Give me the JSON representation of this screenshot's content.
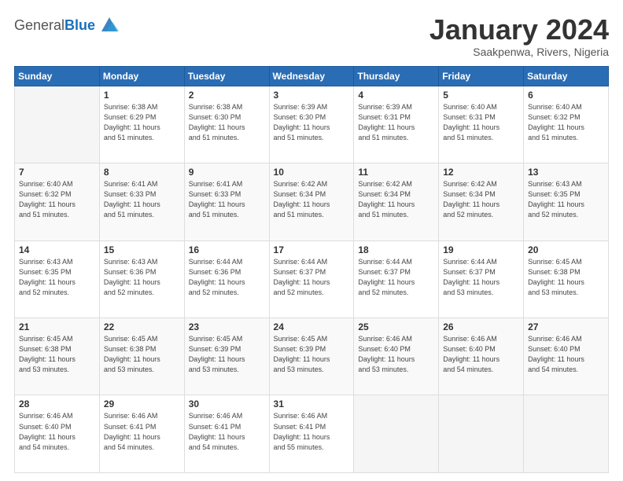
{
  "header": {
    "logo_general": "General",
    "logo_blue": "Blue",
    "month": "January 2024",
    "location": "Saakpenwa, Rivers, Nigeria"
  },
  "days_of_week": [
    "Sunday",
    "Monday",
    "Tuesday",
    "Wednesday",
    "Thursday",
    "Friday",
    "Saturday"
  ],
  "weeks": [
    [
      {
        "day": "",
        "info": ""
      },
      {
        "day": "1",
        "info": "Sunrise: 6:38 AM\nSunset: 6:29 PM\nDaylight: 11 hours\nand 51 minutes."
      },
      {
        "day": "2",
        "info": "Sunrise: 6:38 AM\nSunset: 6:30 PM\nDaylight: 11 hours\nand 51 minutes."
      },
      {
        "day": "3",
        "info": "Sunrise: 6:39 AM\nSunset: 6:30 PM\nDaylight: 11 hours\nand 51 minutes."
      },
      {
        "day": "4",
        "info": "Sunrise: 6:39 AM\nSunset: 6:31 PM\nDaylight: 11 hours\nand 51 minutes."
      },
      {
        "day": "5",
        "info": "Sunrise: 6:40 AM\nSunset: 6:31 PM\nDaylight: 11 hours\nand 51 minutes."
      },
      {
        "day": "6",
        "info": "Sunrise: 6:40 AM\nSunset: 6:32 PM\nDaylight: 11 hours\nand 51 minutes."
      }
    ],
    [
      {
        "day": "7",
        "info": "Sunrise: 6:40 AM\nSunset: 6:32 PM\nDaylight: 11 hours\nand 51 minutes."
      },
      {
        "day": "8",
        "info": "Sunrise: 6:41 AM\nSunset: 6:33 PM\nDaylight: 11 hours\nand 51 minutes."
      },
      {
        "day": "9",
        "info": "Sunrise: 6:41 AM\nSunset: 6:33 PM\nDaylight: 11 hours\nand 51 minutes."
      },
      {
        "day": "10",
        "info": "Sunrise: 6:42 AM\nSunset: 6:34 PM\nDaylight: 11 hours\nand 51 minutes."
      },
      {
        "day": "11",
        "info": "Sunrise: 6:42 AM\nSunset: 6:34 PM\nDaylight: 11 hours\nand 51 minutes."
      },
      {
        "day": "12",
        "info": "Sunrise: 6:42 AM\nSunset: 6:34 PM\nDaylight: 11 hours\nand 52 minutes."
      },
      {
        "day": "13",
        "info": "Sunrise: 6:43 AM\nSunset: 6:35 PM\nDaylight: 11 hours\nand 52 minutes."
      }
    ],
    [
      {
        "day": "14",
        "info": "Sunrise: 6:43 AM\nSunset: 6:35 PM\nDaylight: 11 hours\nand 52 minutes."
      },
      {
        "day": "15",
        "info": "Sunrise: 6:43 AM\nSunset: 6:36 PM\nDaylight: 11 hours\nand 52 minutes."
      },
      {
        "day": "16",
        "info": "Sunrise: 6:44 AM\nSunset: 6:36 PM\nDaylight: 11 hours\nand 52 minutes."
      },
      {
        "day": "17",
        "info": "Sunrise: 6:44 AM\nSunset: 6:37 PM\nDaylight: 11 hours\nand 52 minutes."
      },
      {
        "day": "18",
        "info": "Sunrise: 6:44 AM\nSunset: 6:37 PM\nDaylight: 11 hours\nand 52 minutes."
      },
      {
        "day": "19",
        "info": "Sunrise: 6:44 AM\nSunset: 6:37 PM\nDaylight: 11 hours\nand 53 minutes."
      },
      {
        "day": "20",
        "info": "Sunrise: 6:45 AM\nSunset: 6:38 PM\nDaylight: 11 hours\nand 53 minutes."
      }
    ],
    [
      {
        "day": "21",
        "info": "Sunrise: 6:45 AM\nSunset: 6:38 PM\nDaylight: 11 hours\nand 53 minutes."
      },
      {
        "day": "22",
        "info": "Sunrise: 6:45 AM\nSunset: 6:38 PM\nDaylight: 11 hours\nand 53 minutes."
      },
      {
        "day": "23",
        "info": "Sunrise: 6:45 AM\nSunset: 6:39 PM\nDaylight: 11 hours\nand 53 minutes."
      },
      {
        "day": "24",
        "info": "Sunrise: 6:45 AM\nSunset: 6:39 PM\nDaylight: 11 hours\nand 53 minutes."
      },
      {
        "day": "25",
        "info": "Sunrise: 6:46 AM\nSunset: 6:40 PM\nDaylight: 11 hours\nand 53 minutes."
      },
      {
        "day": "26",
        "info": "Sunrise: 6:46 AM\nSunset: 6:40 PM\nDaylight: 11 hours\nand 54 minutes."
      },
      {
        "day": "27",
        "info": "Sunrise: 6:46 AM\nSunset: 6:40 PM\nDaylight: 11 hours\nand 54 minutes."
      }
    ],
    [
      {
        "day": "28",
        "info": "Sunrise: 6:46 AM\nSunset: 6:40 PM\nDaylight: 11 hours\nand 54 minutes."
      },
      {
        "day": "29",
        "info": "Sunrise: 6:46 AM\nSunset: 6:41 PM\nDaylight: 11 hours\nand 54 minutes."
      },
      {
        "day": "30",
        "info": "Sunrise: 6:46 AM\nSunset: 6:41 PM\nDaylight: 11 hours\nand 54 minutes."
      },
      {
        "day": "31",
        "info": "Sunrise: 6:46 AM\nSunset: 6:41 PM\nDaylight: 11 hours\nand 55 minutes."
      },
      {
        "day": "",
        "info": ""
      },
      {
        "day": "",
        "info": ""
      },
      {
        "day": "",
        "info": ""
      }
    ]
  ]
}
